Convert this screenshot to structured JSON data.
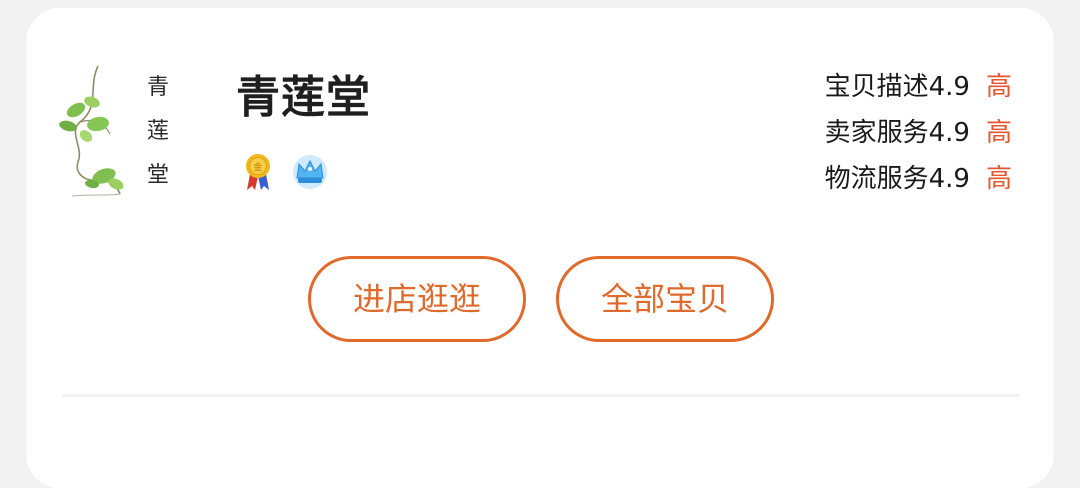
{
  "shop": {
    "name": "青莲堂",
    "logo_text": "青莲堂"
  },
  "badges": [
    {
      "icon": "gold-medal-icon"
    },
    {
      "icon": "crown-icon"
    }
  ],
  "ratings": [
    {
      "label": "宝贝描述",
      "score": "4.9",
      "level": "高"
    },
    {
      "label": "卖家服务",
      "score": "4.9",
      "level": "高"
    },
    {
      "label": "物流服务",
      "score": "4.9",
      "level": "高"
    }
  ],
  "buttons": {
    "enter_shop": "进店逛逛",
    "all_items": "全部宝贝"
  },
  "colors": {
    "accent": "#e06a2c",
    "level_high": "#e4572e",
    "text": "#1a1a1a",
    "background": "#f2f2f2"
  }
}
